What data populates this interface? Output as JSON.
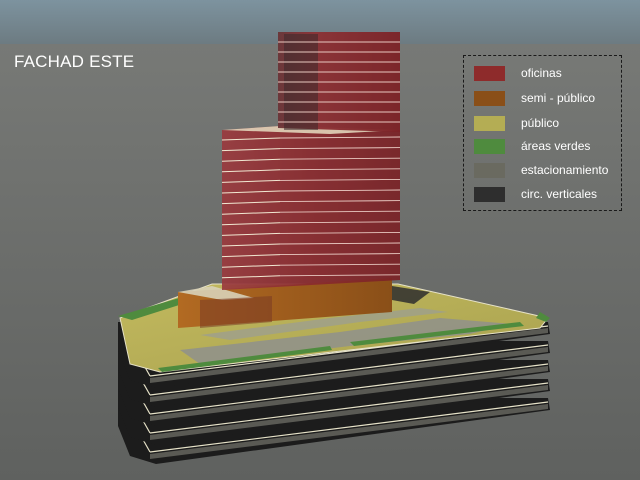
{
  "view_title": "FACHAD ESTE",
  "legend": [
    {
      "label": "oficinas",
      "color": "#8e2b2b"
    },
    {
      "label": "semi - público",
      "color": "#8a4f18"
    },
    {
      "label": "público",
      "color": "#b4ad54"
    },
    {
      "label": "áreas verdes",
      "color": "#4f8b3e"
    },
    {
      "label": "estacionamiento",
      "color": "#6a6a60"
    },
    {
      "label": "circ. verticales",
      "color": "#2e2e2e"
    }
  ],
  "colors": {
    "sky": "#7b8e98",
    "ground": "#6f7170",
    "office_glass": "#8e2b2b",
    "plaza": "#b4ad54",
    "parking_slab": "#1c1c1c",
    "slab_edge": "#e6e2c8"
  }
}
